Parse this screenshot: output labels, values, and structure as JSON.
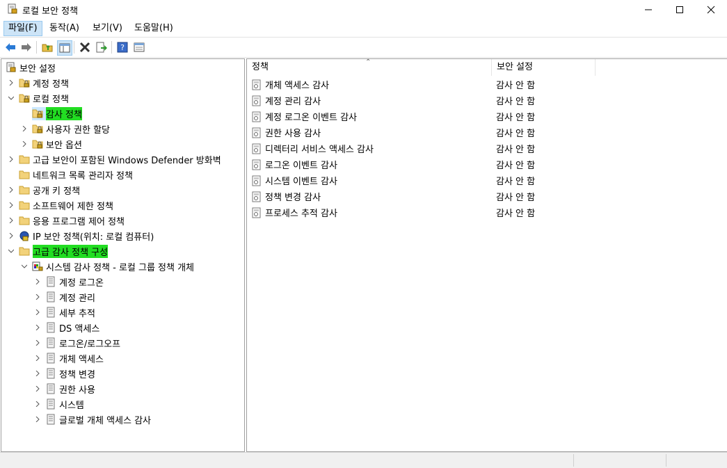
{
  "window": {
    "title": "로컬 보안 정책"
  },
  "menu": [
    "파일(F)",
    "동작(A)",
    "보기(V)",
    "도움말(H)"
  ],
  "toolbar": [
    "back-icon",
    "forward-icon",
    "up-folder-icon",
    "show-hide-tree-icon",
    "delete-icon",
    "export-icon",
    "help-icon",
    "properties-icon"
  ],
  "tree": {
    "root": "보안 설정",
    "account_policies": "계정 정책",
    "local_policies": "로컬 정책",
    "audit_policy": "감사 정책",
    "user_rights": "사용자 권한 할당",
    "security_options": "보안 옵션",
    "firewall": "고급 보안이 포함된 Windows Defender 방화벽",
    "network_list": "네트워크 목록 관리자 정책",
    "public_key": "공개 키 정책",
    "software_restriction": "소프트웨어 제한 정책",
    "app_control": "응용 프로그램 제어 정책",
    "ip_security": "IP 보안 정책(위치: 로컬 컴퓨터)",
    "advanced_audit": "고급 감사 정책 구성",
    "system_audit": "시스템 감사 정책 - 로컬 그룹 정책 개체",
    "subcategories": [
      "계정 로그온",
      "계정 관리",
      "세부 추적",
      "DS 액세스",
      "로그온/로그오프",
      "개체 액세스",
      "정책 변경",
      "권한 사용",
      "시스템",
      "글로벌 개체 액세스 감사"
    ]
  },
  "list": {
    "columns": [
      "정책",
      "보안 설정"
    ],
    "rows": [
      {
        "policy": "개체 액세스 감사",
        "setting": "감사 안 함"
      },
      {
        "policy": "계정 관리 감사",
        "setting": "감사 안 함"
      },
      {
        "policy": "계정 로그온 이벤트 감사",
        "setting": "감사 안 함"
      },
      {
        "policy": "권한 사용 감사",
        "setting": "감사 안 함"
      },
      {
        "policy": "디렉터리 서비스 액세스 감사",
        "setting": "감사 안 함"
      },
      {
        "policy": "로그온 이벤트 감사",
        "setting": "감사 안 함"
      },
      {
        "policy": "시스템 이벤트 감사",
        "setting": "감사 안 함"
      },
      {
        "policy": "정책 변경 감사",
        "setting": "감사 안 함"
      },
      {
        "policy": "프로세스 추적 감사",
        "setting": "감사 안 함"
      }
    ]
  },
  "colors": {
    "highlight": "#22dd22",
    "menu_active": "#cce4f7"
  }
}
